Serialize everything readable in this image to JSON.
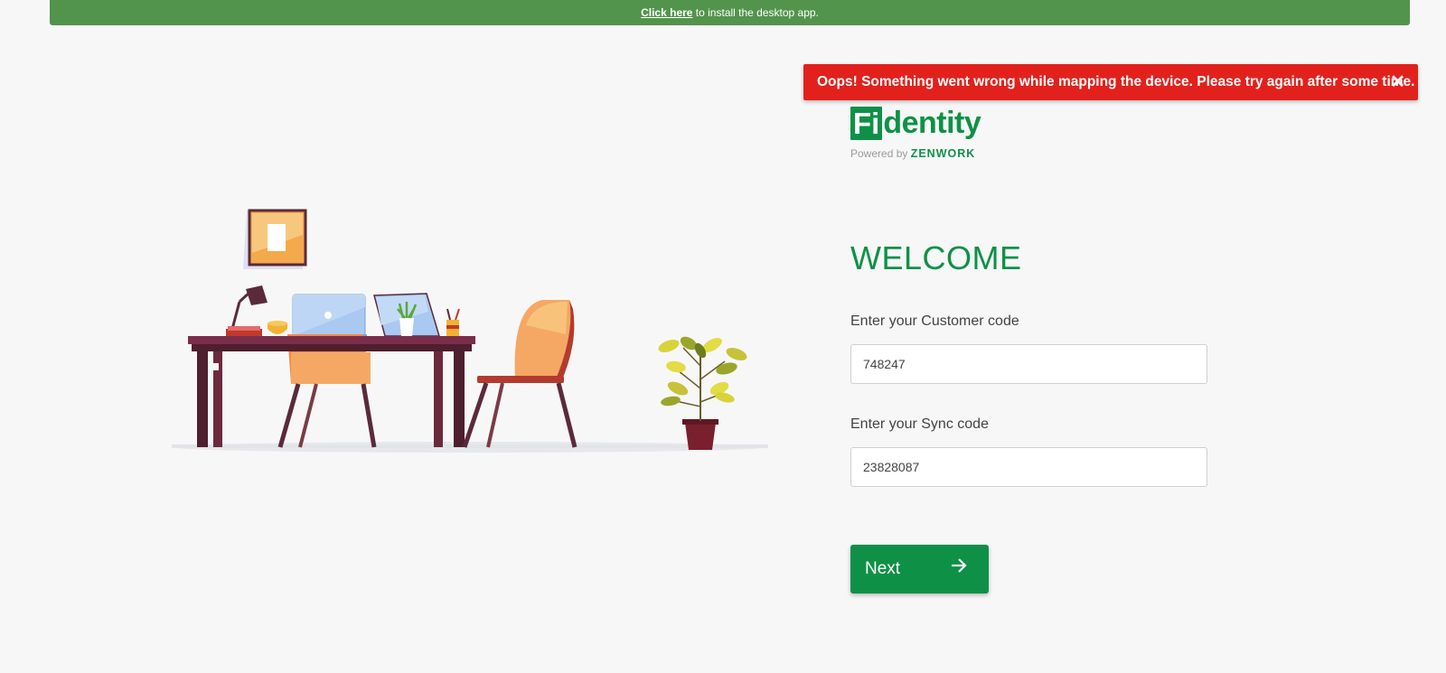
{
  "banner": {
    "link_text": "Click here",
    "text": " to install the desktop app."
  },
  "error": {
    "message": "Oops! Something went wrong while mapping the device. Please try again after some time.",
    "close_glyph": "✕"
  },
  "logo": {
    "fi": "Fi",
    "rest": "dentity",
    "powered_by": "Powered by ",
    "brand": "ZENWORK"
  },
  "form": {
    "title": "WELCOME",
    "customer_label": "Enter your Customer code",
    "customer_value": "748247",
    "sync_label": "Enter your Sync code",
    "sync_value": "23828087",
    "next_label": "Next"
  },
  "icons": {
    "close": "close-icon",
    "next": "arrow-right-icon"
  },
  "colors": {
    "brand_green": "#0e9147",
    "banner_green": "#52944b",
    "error_red": "#e2211c",
    "background": "#f7f7f7"
  }
}
